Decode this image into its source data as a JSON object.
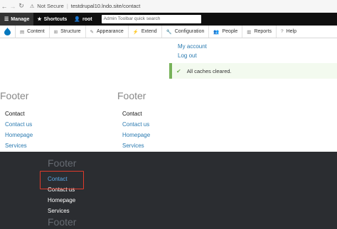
{
  "browser": {
    "back_icon": "back-arrow",
    "forward_icon": "forward-arrow",
    "reload_icon": "reload",
    "security_label": "Not Secure",
    "url": "testdrupal10.lndo.site/contact"
  },
  "toolbar": {
    "manage_label": "Manage",
    "shortcuts_label": "Shortcuts",
    "user_label": "root",
    "search_placeholder": "Admin Toolbar quick search"
  },
  "tray": {
    "items": [
      {
        "label": "Content",
        "icon": "content-icon"
      },
      {
        "label": "Structure",
        "icon": "structure-icon"
      },
      {
        "label": "Appearance",
        "icon": "appearance-icon"
      },
      {
        "label": "Extend",
        "icon": "extend-icon"
      },
      {
        "label": "Configuration",
        "icon": "configuration-icon"
      },
      {
        "label": "People",
        "icon": "people-icon"
      },
      {
        "label": "Reports",
        "icon": "reports-icon"
      },
      {
        "label": "Help",
        "icon": "help-icon"
      }
    ]
  },
  "account_menu": {
    "my_account": "My account",
    "log_out": "Log out"
  },
  "status_message": "All caches cleared.",
  "footer_blocks": [
    {
      "title": "Footer",
      "links": [
        "Contact",
        "Contact us",
        "Homepage",
        "Services"
      ]
    },
    {
      "title": "Footer",
      "links": [
        "Contact",
        "Contact us",
        "Homepage",
        "Services"
      ]
    }
  ],
  "dark_footer": {
    "title": "Footer",
    "links": [
      "Contact",
      "Contact us",
      "Homepage",
      "Services"
    ],
    "second_title": "Footer"
  },
  "colors": {
    "link": "#2a7ab0",
    "active_dark_link": "#58a8e8",
    "highlight": "#e03a2a",
    "status_green": "#77b259",
    "dark_footer_bg": "#2b2d31"
  }
}
